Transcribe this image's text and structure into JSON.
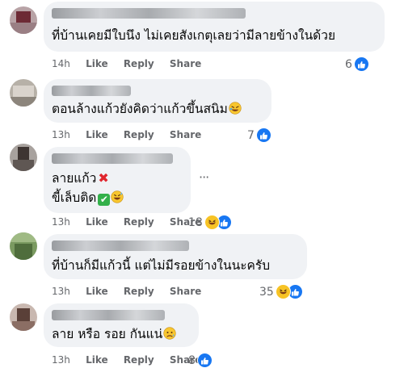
{
  "comments": [
    {
      "text_lines": [
        "ที่บ้านเคยมีใบนึง ไม่เคยสังเกตุเลยว่ามีลายข้างในด้วย"
      ],
      "time": "14h",
      "like_label": "Like",
      "reply_label": "Reply",
      "share_label": "Share",
      "reaction_count": "6",
      "reactions": [
        "like-icon"
      ]
    },
    {
      "text_lines": [
        "ตอนล้างแก้วยังคิดว่าแก้วขึ้นสนิม"
      ],
      "time": "13h",
      "like_label": "Like",
      "reply_label": "Reply",
      "share_label": "Share",
      "reaction_count": "7",
      "reactions": [
        "like-icon"
      ]
    },
    {
      "text_lines": [
        "ลายแก้ว",
        "ขี้เล็บติด"
      ],
      "time": "13h",
      "like_label": "Like",
      "reply_label": "Reply",
      "share_label": "Share",
      "reaction_count": "18",
      "reactions": [
        "haha-icon",
        "like-icon"
      ]
    },
    {
      "text_lines": [
        "ที่บ้านก็มีแก้วนี้ แต่ไม่มีรอยข้างในนะครับ"
      ],
      "time": "13h",
      "like_label": "Like",
      "reply_label": "Reply",
      "share_label": "Share",
      "reaction_count": "35",
      "reactions": [
        "haha-icon",
        "like-icon"
      ]
    },
    {
      "text_lines": [
        "ลาย หรือ รอย กันแน่"
      ],
      "time": "13h",
      "like_label": "Like",
      "reply_label": "Reply",
      "share_label": "Share",
      "reaction_count": "8",
      "reactions": [
        "like-icon"
      ]
    }
  ],
  "colors": {
    "bubble": "#f0f2f5",
    "meta_text": "#65676b",
    "like_blue": "#1877f2",
    "haha_yellow": "#f7c325"
  }
}
